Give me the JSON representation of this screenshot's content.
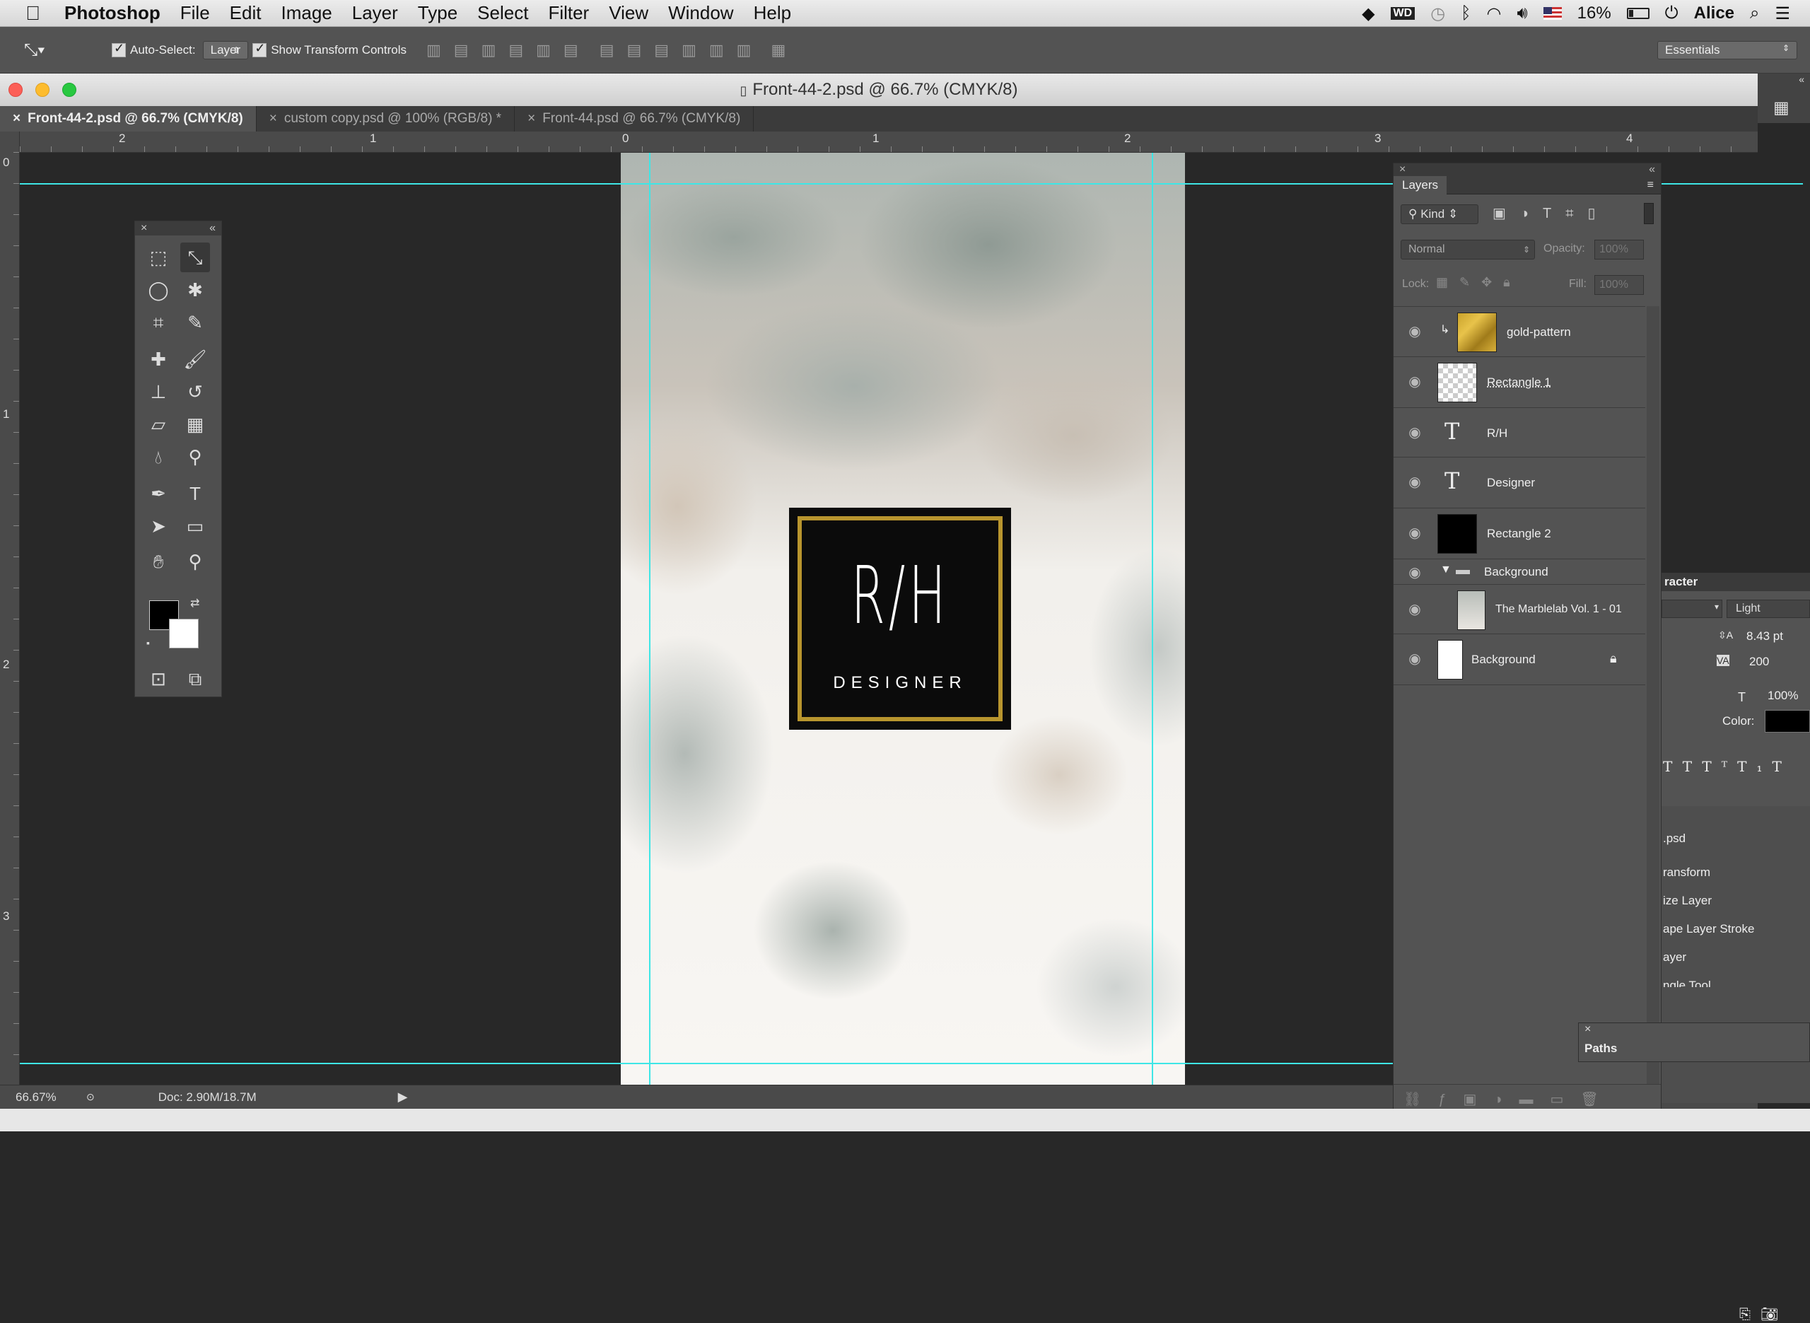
{
  "menubar": {
    "apple": "",
    "app": "Photoshop",
    "items": [
      "File",
      "Edit",
      "Image",
      "Layer",
      "Type",
      "Select",
      "Filter",
      "View",
      "Window",
      "Help"
    ],
    "battery": "16%",
    "user": "Alice"
  },
  "options": {
    "auto_select_label": "Auto-Select:",
    "auto_select_value": "Layer",
    "show_transform_label": "Show Transform Controls",
    "workspace": "Essentials"
  },
  "document": {
    "title": "Front-44-2.psd @ 66.7% (CMYK/8)",
    "tabs": [
      "Front-44-2.psd @ 66.7% (CMYK/8)",
      "custom copy.psd @ 100% (RGB/8) *",
      "Front-44.psd @ 66.7% (CMYK/8)"
    ]
  },
  "rulers": {
    "h": [
      "2",
      "1",
      "0",
      "1",
      "2",
      "3",
      "4"
    ],
    "v": [
      "0",
      "1",
      "2",
      "3"
    ]
  },
  "artwork": {
    "monogram": "R/H",
    "subtitle": "DESIGNER"
  },
  "status": {
    "zoom": "66.67%",
    "doc": "Doc: 2.90M/18.7M"
  },
  "layers": {
    "title": "Layers",
    "filter_kind": "Kind",
    "blend_mode": "Normal",
    "opacity_label": "Opacity:",
    "opacity_value": "100%",
    "lock_label": "Lock:",
    "fill_label": "Fill:",
    "fill_value": "100%",
    "items": [
      {
        "name": "gold-pattern"
      },
      {
        "name": "Rectangle 1"
      },
      {
        "name": "R/H"
      },
      {
        "name": "Designer"
      },
      {
        "name": "Rectangle 2"
      },
      {
        "name": "Background"
      },
      {
        "name": "The Marblelab Vol. 1 - 01"
      },
      {
        "name": "Background"
      }
    ]
  },
  "character": {
    "title": "racter",
    "font_style": "Light",
    "leading": "8.43 pt",
    "tracking": "200",
    "scale": "100%",
    "color_label": "Color:"
  },
  "history": {
    "items": [
      ".psd",
      "ransform",
      "ize Layer",
      "ape Layer Stroke",
      "ayer",
      "ngle Tool"
    ]
  },
  "paths": {
    "title": "Paths"
  }
}
